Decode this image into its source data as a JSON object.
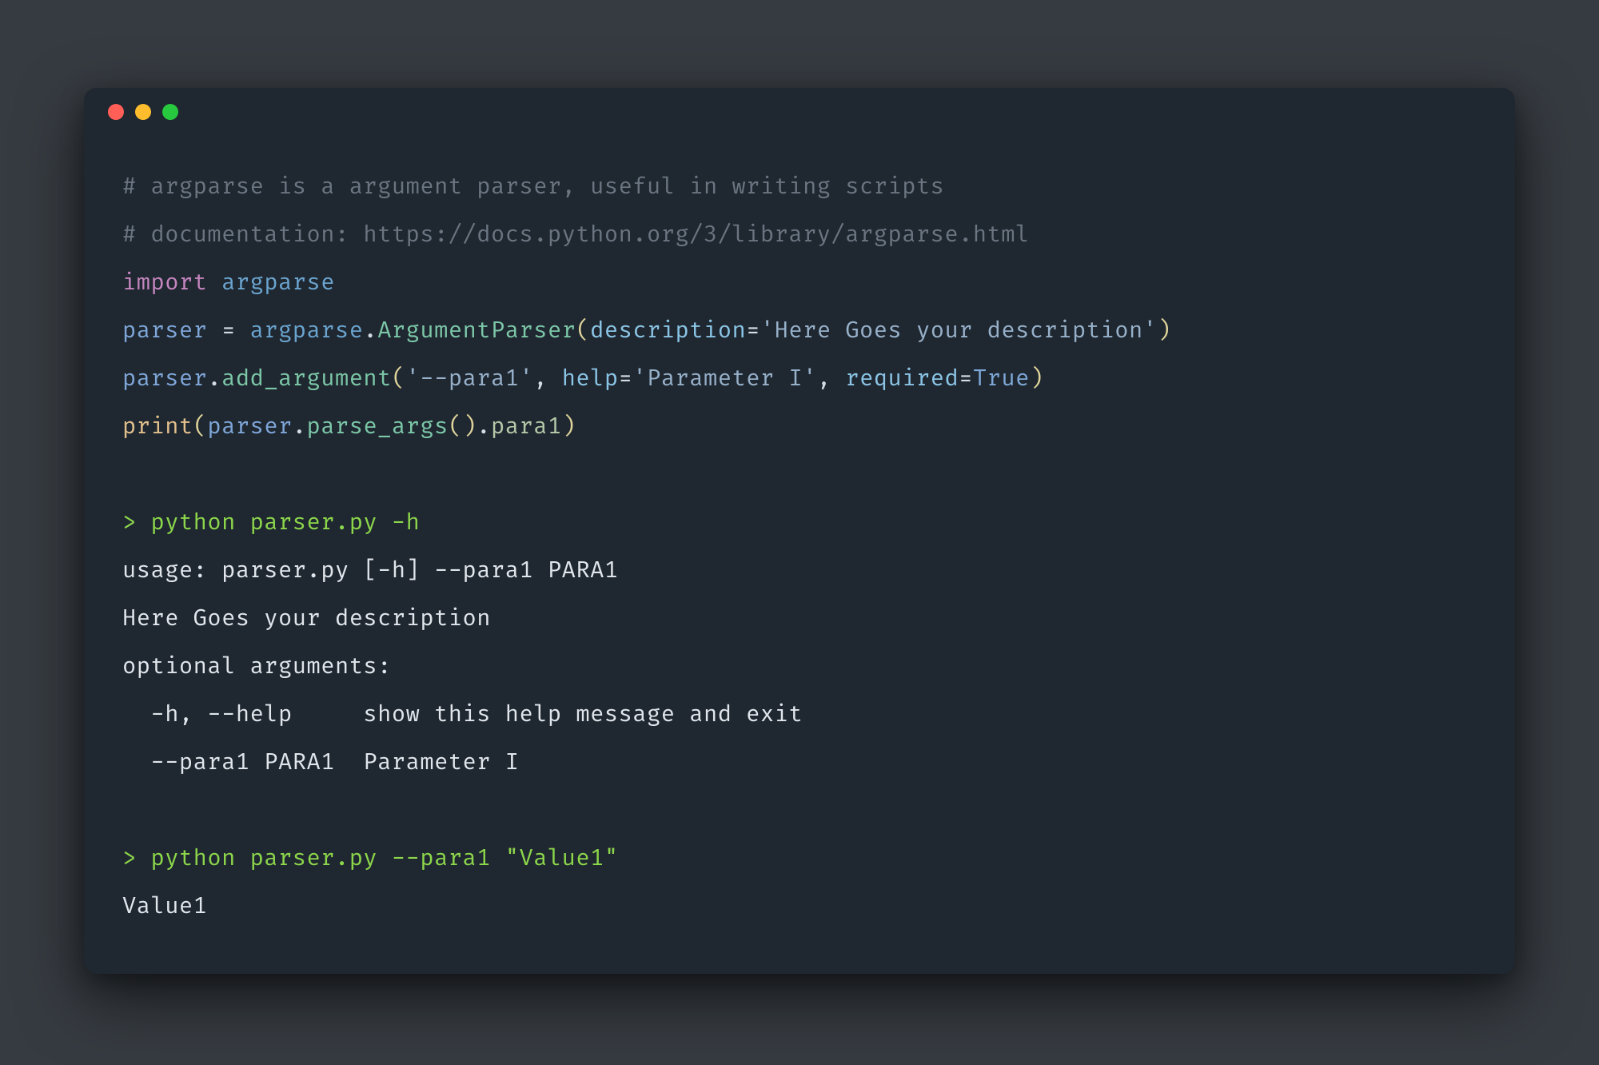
{
  "code": {
    "comment1": "# argparse is a argument parser, useful in writing scripts",
    "comment2": "# documentation: https://docs.python.org/3/library/argparse.html",
    "l3": {
      "import": "import",
      "mod": "argparse"
    },
    "l4": {
      "var": "parser",
      "eq": " = ",
      "mod": "argparse",
      "dot": ".",
      "cls": "ArgumentParser",
      "op1": "(",
      "kw": "description",
      "eq2": "=",
      "str": "'Here Goes your description'",
      "op2": ")"
    },
    "l5": {
      "var": "parser",
      "dot": ".",
      "fn": "add_argument",
      "op1": "(",
      "str1": "'--para1'",
      "c1": ", ",
      "kw1": "help",
      "eq1": "=",
      "str2": "'Parameter I'",
      "c2": ", ",
      "kw2": "required",
      "eq2": "=",
      "bool": "True",
      "op2": ")"
    },
    "l6": {
      "print": "print",
      "op1": "(",
      "var": "parser",
      "dot": ".",
      "fn": "parse_args",
      "op2": "(",
      "op3": ")",
      "dot2": ".",
      "attr": "para1",
      "op4": ")"
    }
  },
  "term": {
    "cmd1": "> python parser.py -h",
    "out1a": "usage: parser.py [-h] --para1 PARA1",
    "out1b": "Here Goes your description",
    "out1c": "optional arguments:",
    "out1d": "  -h, --help     show this help message and exit",
    "out1e": "  --para1 PARA1  Parameter I",
    "cmd2": "> python parser.py --para1 \"Value1\"",
    "out2": "Value1"
  }
}
